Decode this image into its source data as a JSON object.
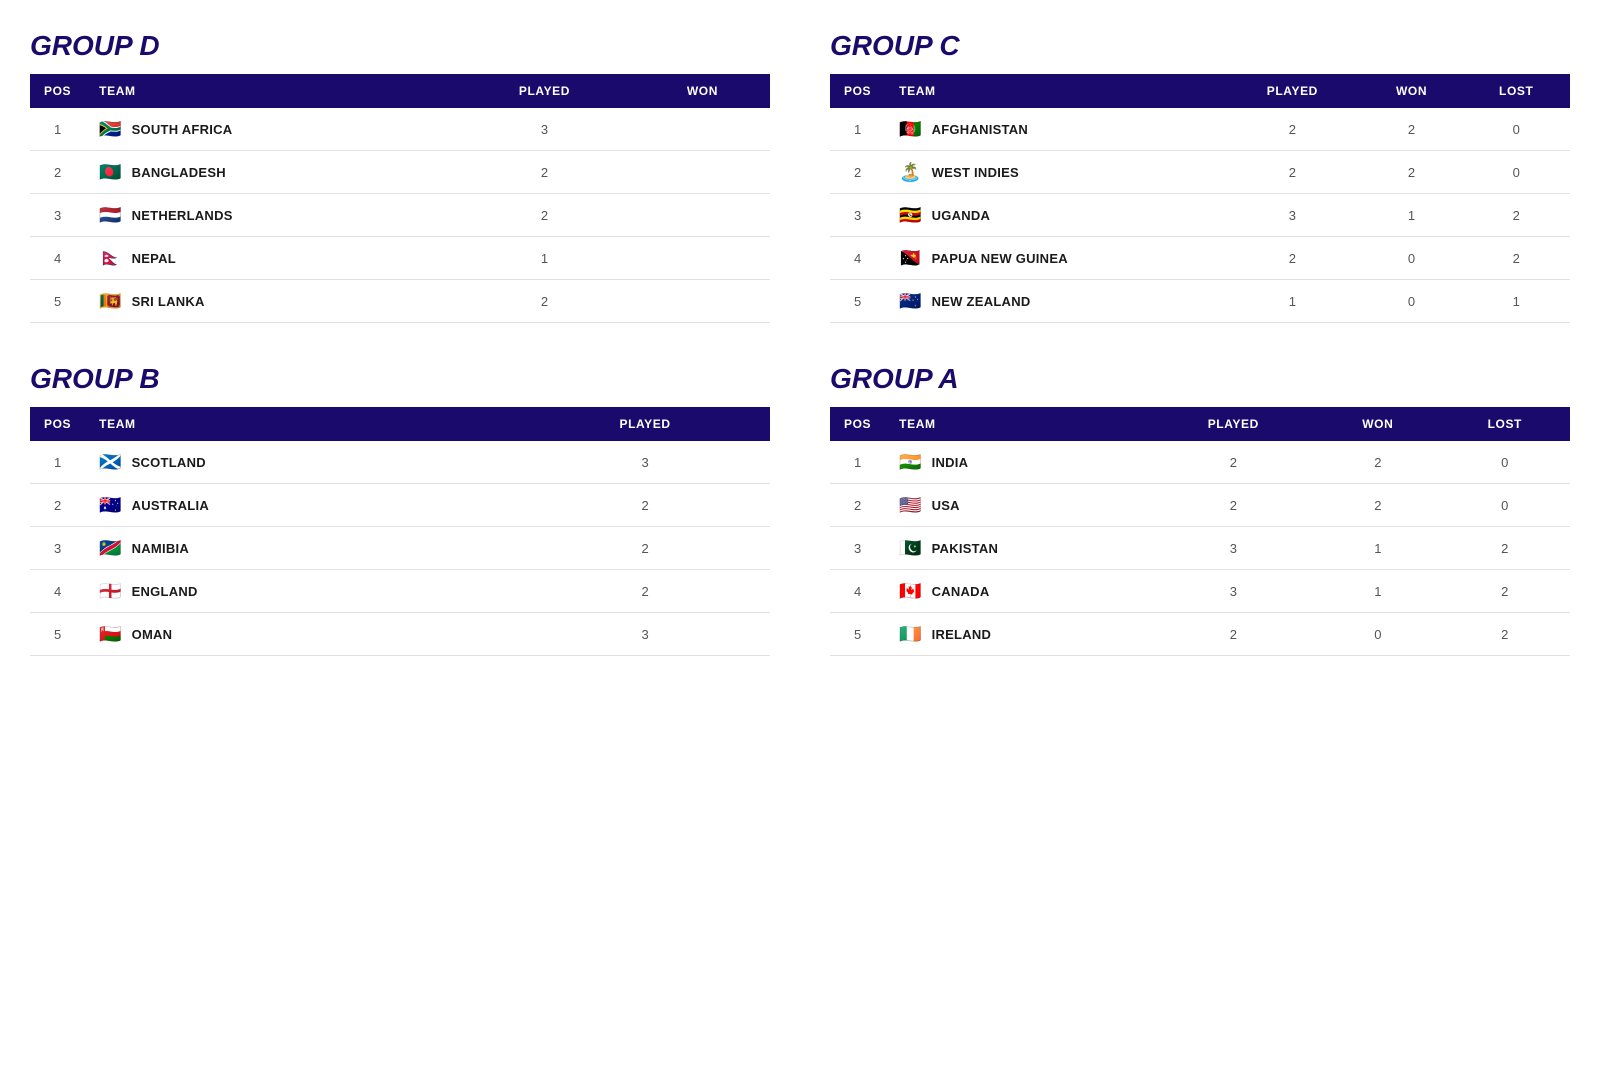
{
  "groups": [
    {
      "id": "group-d",
      "title": "GROUP D",
      "columns": [
        "POS",
        "TEAM",
        "PLAYED",
        "WON"
      ],
      "teams": [
        {
          "pos": 1,
          "flag": "🇿🇦",
          "name": "SOUTH AFRICA",
          "played": 3,
          "won": null
        },
        {
          "pos": 2,
          "flag": "🇧🇩",
          "name": "BANGLADESH",
          "played": 2,
          "won": null
        },
        {
          "pos": 3,
          "flag": "🇳🇱",
          "name": "NETHERLANDS",
          "played": 2,
          "won": null
        },
        {
          "pos": 4,
          "flag": "🇳🇵",
          "name": "NEPAL",
          "played": 1,
          "won": null
        },
        {
          "pos": 5,
          "flag": "🇱🇰",
          "name": "SRI LANKA",
          "played": 2,
          "won": null
        }
      ]
    },
    {
      "id": "group-c",
      "title": "GROUP C",
      "columns": [
        "POS",
        "TEAM",
        "PLAYED",
        "WON",
        "LOST"
      ],
      "teams": [
        {
          "pos": 1,
          "flag": "🇦🇫",
          "name": "AFGHANISTAN",
          "played": 2,
          "won": 2,
          "lost": 0
        },
        {
          "pos": 2,
          "flag": "🏝️",
          "name": "WEST INDIES",
          "played": 2,
          "won": 2,
          "lost": 0
        },
        {
          "pos": 3,
          "flag": "🇺🇬",
          "name": "UGANDA",
          "played": 3,
          "won": 1,
          "lost": 2
        },
        {
          "pos": 4,
          "flag": "🇵🇬",
          "name": "PAPUA NEW GUINEA",
          "played": 2,
          "won": 0,
          "lost": 2
        },
        {
          "pos": 5,
          "flag": "🇳🇿",
          "name": "NEW ZEALAND",
          "played": 1,
          "won": 0,
          "lost": 1
        }
      ]
    },
    {
      "id": "group-b",
      "title": "GROUP B",
      "columns": [
        "POS",
        "TEAM",
        "PLAYED"
      ],
      "teams": [
        {
          "pos": 1,
          "flag": "🏴󠁧󠁢󠁳󠁣󠁴󠁿",
          "name": "SCOTLAND",
          "played": 3,
          "won": null
        },
        {
          "pos": 2,
          "flag": "🇦🇺",
          "name": "AUSTRALIA",
          "played": 2,
          "won": null
        },
        {
          "pos": 3,
          "flag": "🇳🇦",
          "name": "NAMIBIA",
          "played": 2,
          "won": null
        },
        {
          "pos": 4,
          "flag": "🏴󠁧󠁢󠁥󠁮󠁧󠁿",
          "name": "ENGLAND",
          "played": 2,
          "won": null
        },
        {
          "pos": 5,
          "flag": "🇴🇲",
          "name": "OMAN",
          "played": 3,
          "won": null
        }
      ]
    },
    {
      "id": "group-a",
      "title": "GROUP A",
      "columns": [
        "POS",
        "TEAM",
        "PLAYED",
        "WON",
        "LOST"
      ],
      "teams": [
        {
          "pos": 1,
          "flag": "🇮🇳",
          "name": "INDIA",
          "played": 2,
          "won": 2,
          "lost": 0
        },
        {
          "pos": 2,
          "flag": "🇺🇸",
          "name": "USA",
          "played": 2,
          "won": 2,
          "lost": 0
        },
        {
          "pos": 3,
          "flag": "🇵🇰",
          "name": "PAKISTAN",
          "played": 3,
          "won": 1,
          "lost": 2
        },
        {
          "pos": 4,
          "flag": "🇨🇦",
          "name": "CANADA",
          "played": 3,
          "won": 1,
          "lost": 2
        },
        {
          "pos": 5,
          "flag": "🇮🇪",
          "name": "IRELAND",
          "played": 2,
          "won": 0,
          "lost": 2
        }
      ]
    }
  ]
}
